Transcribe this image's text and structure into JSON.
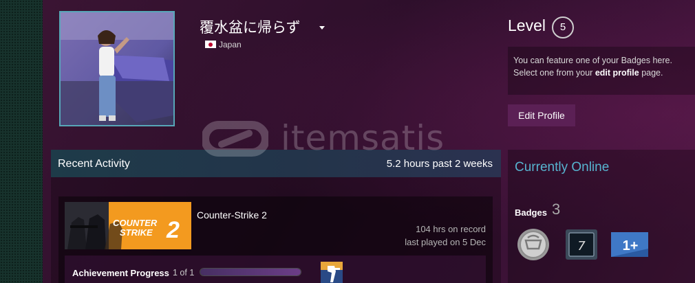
{
  "profile": {
    "name": "覆水盆に帰らず",
    "country": "Japan",
    "country_flag": "flag-jp-icon"
  },
  "level": {
    "label": "Level",
    "value": "5"
  },
  "badge_note": {
    "line1": "You can feature one of your Badges here.",
    "line2_pre": "Select one from your ",
    "line2_link": "edit profile",
    "line2_post": " page."
  },
  "edit_profile_label": "Edit Profile",
  "watermark": "itemsatis",
  "recent_activity": {
    "title": "Recent Activity",
    "hours": "5.2 hours past 2 weeks",
    "game": {
      "name": "Counter-Strike 2",
      "capsule_title_line1": "COUNTER",
      "capsule_title_line2": "STRIKE",
      "capsule_number": "2",
      "hours_on_record": "104 hrs on record",
      "last_played": "last played on 5 Dec",
      "achievement_label": "Achievement Progress",
      "achievement_count": "1 of 1",
      "achievement_fraction": 1.0
    }
  },
  "status": {
    "online": "Currently Online"
  },
  "badges": {
    "label": "Badges",
    "count": "3",
    "items": [
      {
        "icon": "silver-coin-badge-icon"
      },
      {
        "icon": "years-of-service-badge-icon",
        "text": "7"
      },
      {
        "icon": "one-plus-badge-icon",
        "text": "1+"
      }
    ]
  },
  "colors": {
    "accent_online": "#57b4d0",
    "edit_button_bg": "#5b2055",
    "background": "#2e0f2b",
    "sidebar": "#17322c",
    "cs2_orange": "#f39a1f"
  }
}
